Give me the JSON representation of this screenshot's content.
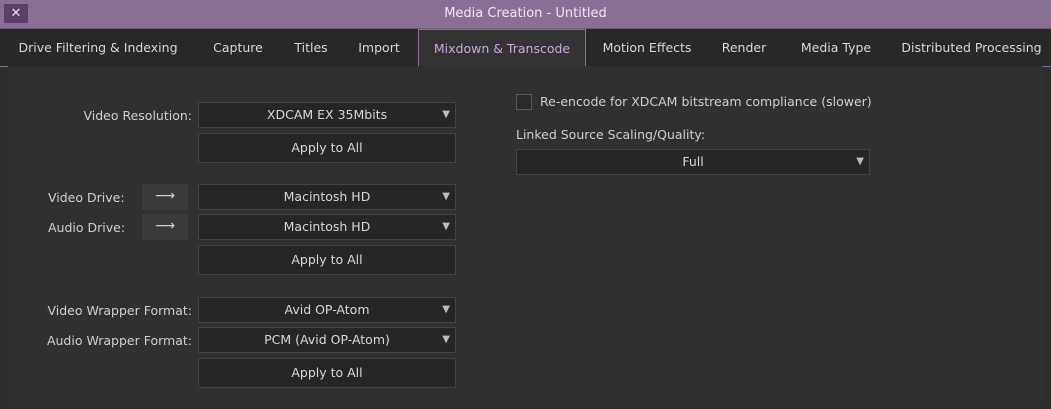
{
  "window": {
    "title": "Media Creation - Untitled",
    "close_glyph": "✕",
    "accent": "#8a6f94"
  },
  "tabs": [
    {
      "label": "Drive Filtering & Indexing",
      "active": false
    },
    {
      "label": "Capture",
      "active": false
    },
    {
      "label": "Titles",
      "active": false
    },
    {
      "label": "Import",
      "active": false
    },
    {
      "label": "Mixdown & Transcode",
      "active": true
    },
    {
      "label": "Motion Effects",
      "active": false
    },
    {
      "label": "Render",
      "active": false
    },
    {
      "label": "Media Type",
      "active": false
    },
    {
      "label": "Distributed Processing",
      "active": false
    }
  ],
  "video_resolution": {
    "label": "Video Resolution:",
    "value": "XDCAM EX 35Mbits",
    "apply_label": "Apply to All"
  },
  "drives": {
    "video_label": "Video Drive:",
    "video_value": "Macintosh HD",
    "audio_label": "Audio Drive:",
    "audio_value": "Macintosh HD",
    "arrow_glyph": "⟶",
    "apply_label": "Apply to All"
  },
  "wrappers": {
    "video_label": "Video Wrapper Format:",
    "video_value": "Avid OP-Atom",
    "audio_label": "Audio Wrapper Format:",
    "audio_value": "PCM (Avid OP-Atom)",
    "apply_label": "Apply to All"
  },
  "reencode": {
    "label": "Re-encode for XDCAM bitstream compliance (slower)",
    "checked": false
  },
  "linked_scaling": {
    "label": "Linked Source Scaling/Quality:",
    "value": "Full"
  },
  "dropdown_glyph": "▼"
}
